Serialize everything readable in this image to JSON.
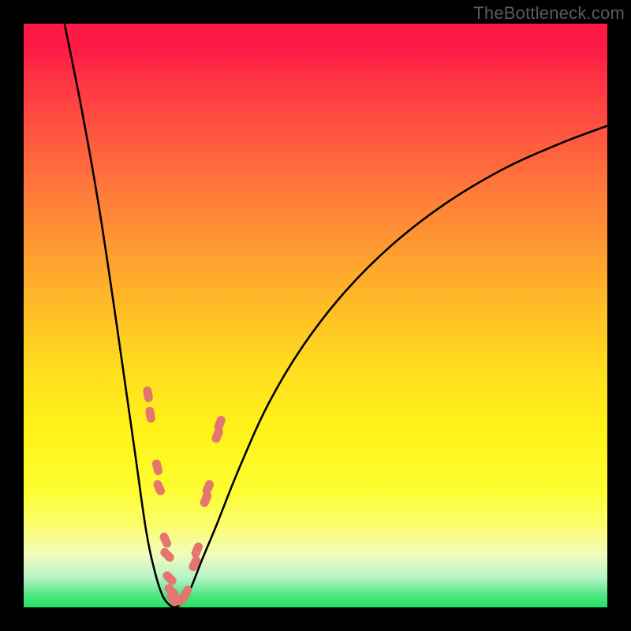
{
  "watermark": "TheBottleneck.com",
  "chart_data": {
    "type": "line",
    "title": "",
    "xlabel": "",
    "ylabel": "",
    "xlim": [
      0,
      100
    ],
    "ylim": [
      0,
      100
    ],
    "curve": {
      "left": {
        "x": [
          7,
          10,
          13,
          16,
          19,
          21,
          22.5,
          23.8,
          25,
          25.8
        ],
        "y": [
          100,
          85,
          68,
          48,
          27,
          13,
          6,
          2,
          0.4,
          0
        ]
      },
      "right": {
        "x": [
          25.8,
          27,
          28.5,
          30.5,
          33,
          37,
          42,
          48,
          55,
          63,
          72,
          82,
          92,
          100
        ],
        "y": [
          0,
          0.6,
          3,
          8,
          14,
          24,
          35,
          45,
          54,
          62,
          69,
          75,
          79.5,
          82.5
        ]
      }
    },
    "markers": [
      {
        "x": 21.3,
        "y": 36.5
      },
      {
        "x": 21.7,
        "y": 33.0
      },
      {
        "x": 22.9,
        "y": 24.0
      },
      {
        "x": 23.2,
        "y": 20.5
      },
      {
        "x": 24.3,
        "y": 11.5
      },
      {
        "x": 24.6,
        "y": 9.0
      },
      {
        "x": 25.0,
        "y": 5.0
      },
      {
        "x": 25.3,
        "y": 2.8
      },
      {
        "x": 25.8,
        "y": 1.5
      },
      {
        "x": 26.4,
        "y": 1.2
      },
      {
        "x": 27.2,
        "y": 1.5
      },
      {
        "x": 27.8,
        "y": 2.4
      },
      {
        "x": 29.3,
        "y": 7.5
      },
      {
        "x": 29.7,
        "y": 9.8
      },
      {
        "x": 31.2,
        "y": 18.5
      },
      {
        "x": 31.6,
        "y": 20.5
      },
      {
        "x": 33.2,
        "y": 29.5
      },
      {
        "x": 33.6,
        "y": 31.5
      }
    ],
    "marker_color": "#e4766f",
    "curve_color": "#000000",
    "background": "rainbow-vertical"
  }
}
